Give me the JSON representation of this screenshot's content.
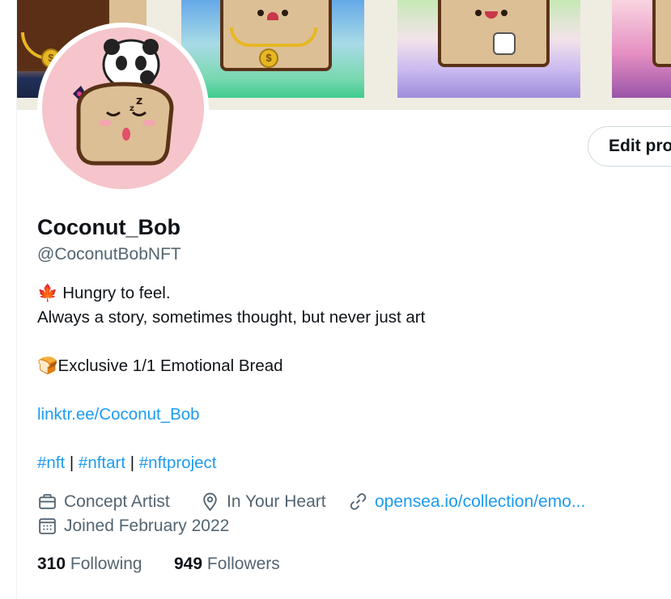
{
  "profile": {
    "display_name": "Coconut_Bob",
    "handle": "@CoconutBobNFT",
    "edit_button": "Edit profile",
    "bio": {
      "line1_flag": "🍁",
      "line1": " Hungry to feel.",
      "line2": "Always a story, sometimes thought, but never just art",
      "line3_icon": "🍞",
      "line3": "Exclusive 1/1 Emotional Bread",
      "link": "linktr.ee/Coconut_Bob",
      "hashtags": [
        "#nft",
        "#nftart",
        "#nftproject"
      ],
      "separator": " | "
    },
    "meta": {
      "profession": "Concept Artist",
      "location": "In Your Heart",
      "website": "opensea.io/collection/emo...",
      "joined": "Joined February 2022"
    },
    "stats": {
      "following_count": "310",
      "following_label": "Following",
      "followers_count": "949",
      "followers_label": "Followers"
    }
  },
  "icons": [
    "briefcase-icon",
    "location-pin-icon",
    "link-icon",
    "calendar-icon"
  ],
  "colors": {
    "accent": "#1d9bf0",
    "muted": "#536471",
    "text": "#0f1419"
  }
}
